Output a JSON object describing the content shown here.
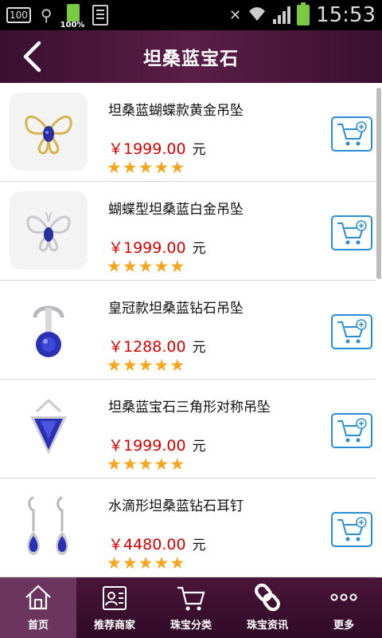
{
  "status_bar": {
    "box_label": "100",
    "battery_small_pct": "100%",
    "time": "15:53"
  },
  "header": {
    "title": "坦桑蓝宝石"
  },
  "products": [
    {
      "name": "坦桑蓝蝴蝶款黄金吊坠",
      "price": "￥1999.00",
      "unit": "元",
      "rating": 5,
      "image_icon": "butterfly-gold-pendant-image"
    },
    {
      "name": "蝴蝶型坦桑蓝白金吊坠",
      "price": "￥1999.00",
      "unit": "元",
      "rating": 5,
      "image_icon": "butterfly-white-gold-pendant-image"
    },
    {
      "name": "皇冠款坦桑蓝钻石吊坠",
      "price": "￥1288.00",
      "unit": "元",
      "rating": 5,
      "image_icon": "crown-pendant-image"
    },
    {
      "name": "坦桑蓝宝石三角形对称吊坠",
      "price": "￥1999.00",
      "unit": "元",
      "rating": 5,
      "image_icon": "triangle-pendant-image"
    },
    {
      "name": "水滴形坦桑蓝钻石耳钉",
      "price": "￥4480.00",
      "unit": "元",
      "rating": 5,
      "image_icon": "drop-earrings-image"
    }
  ],
  "bottom_nav": [
    {
      "label": "首页",
      "icon": "home-icon",
      "active": true
    },
    {
      "label": "推荐商家",
      "icon": "merchant-card-icon",
      "active": false
    },
    {
      "label": "珠宝分类",
      "icon": "cart-icon",
      "active": false
    },
    {
      "label": "珠宝资讯",
      "icon": "link-icon",
      "active": false
    },
    {
      "label": "更多",
      "icon": "more-dots-icon",
      "active": false
    }
  ],
  "colors": {
    "header_bg": "#4a153a",
    "price": "#d40000",
    "star": "#f7a51c",
    "cart_border": "#2a8ed6"
  }
}
